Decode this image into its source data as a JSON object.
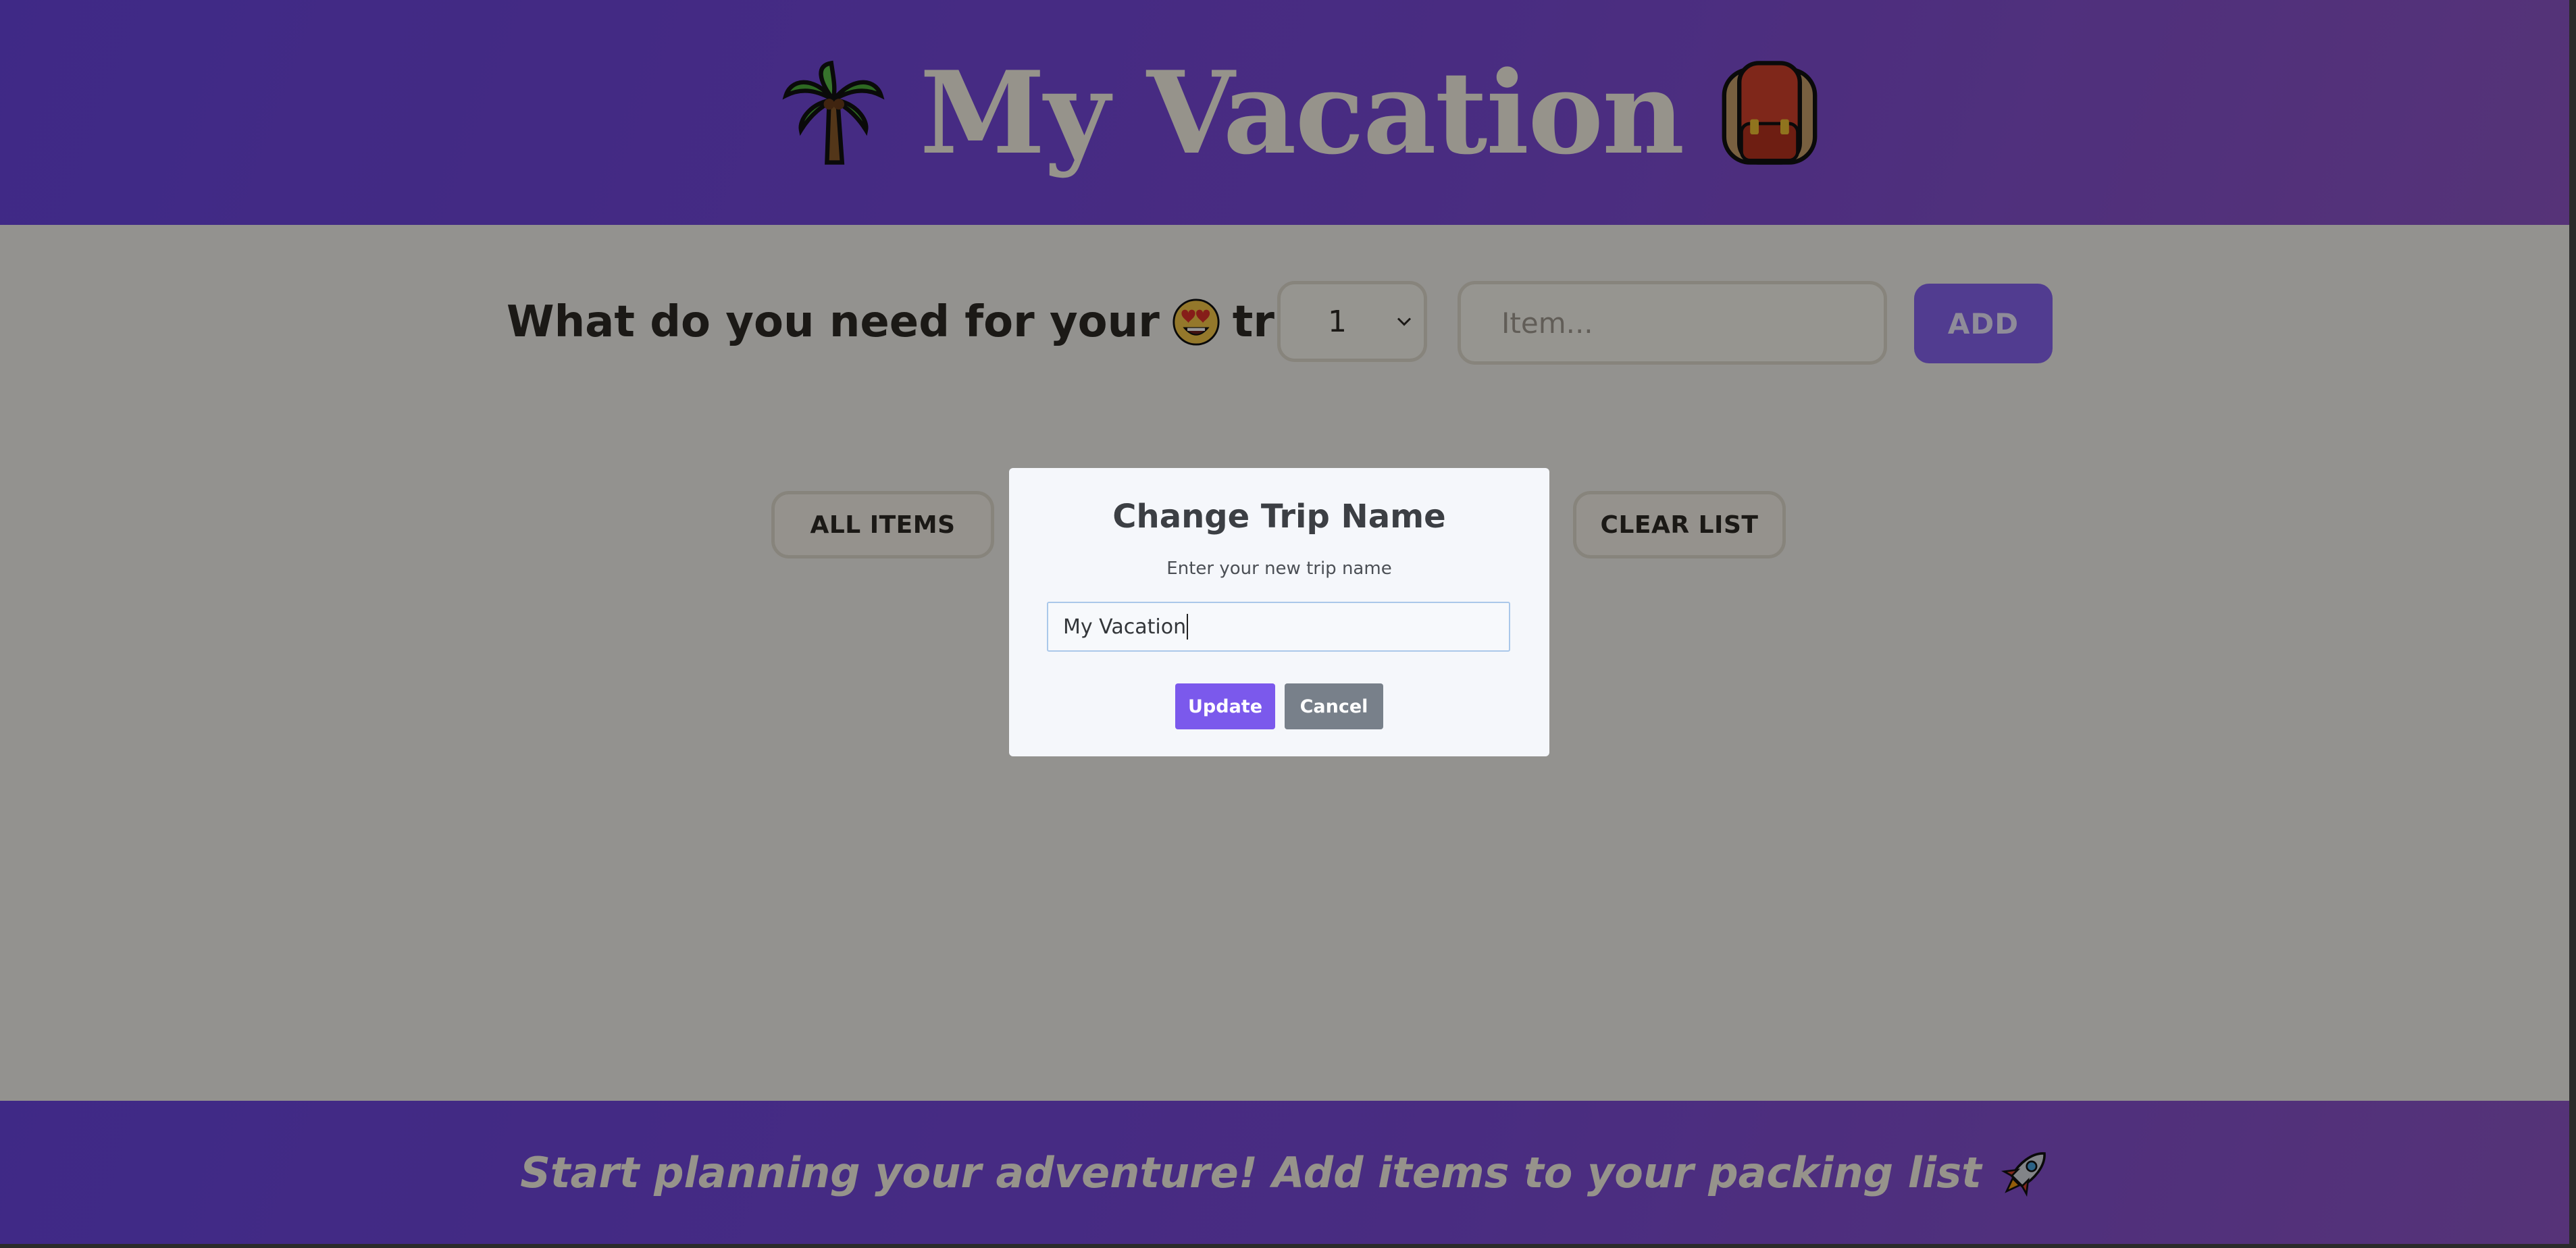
{
  "header": {
    "title": "My Vacation",
    "left_icon": "palm-tree-icon",
    "right_icon": "backpack-icon"
  },
  "form": {
    "question_before": "What do you need for your",
    "question_after": "trip?",
    "emoji": "heart-eyes-face-icon",
    "quantity_value": "1",
    "item_placeholder": "Item...",
    "add_label": "ADD"
  },
  "filters": {
    "all_items_label": "ALL ITEMS",
    "clear_list_label": "CLEAR LIST"
  },
  "footer": {
    "message": "Start planning your adventure! Add items to your packing list",
    "icon": "rocket-icon"
  },
  "modal": {
    "title": "Change Trip Name",
    "subtitle": "Enter your new trip name",
    "input_value": "My Vacation",
    "update_label": "Update",
    "cancel_label": "Cancel"
  },
  "colors": {
    "accent": "#7b59ec",
    "header_gradient_start": "#6a45e0",
    "header_gradient_end": "#8f56c8",
    "cancel_gray": "#78808a"
  }
}
